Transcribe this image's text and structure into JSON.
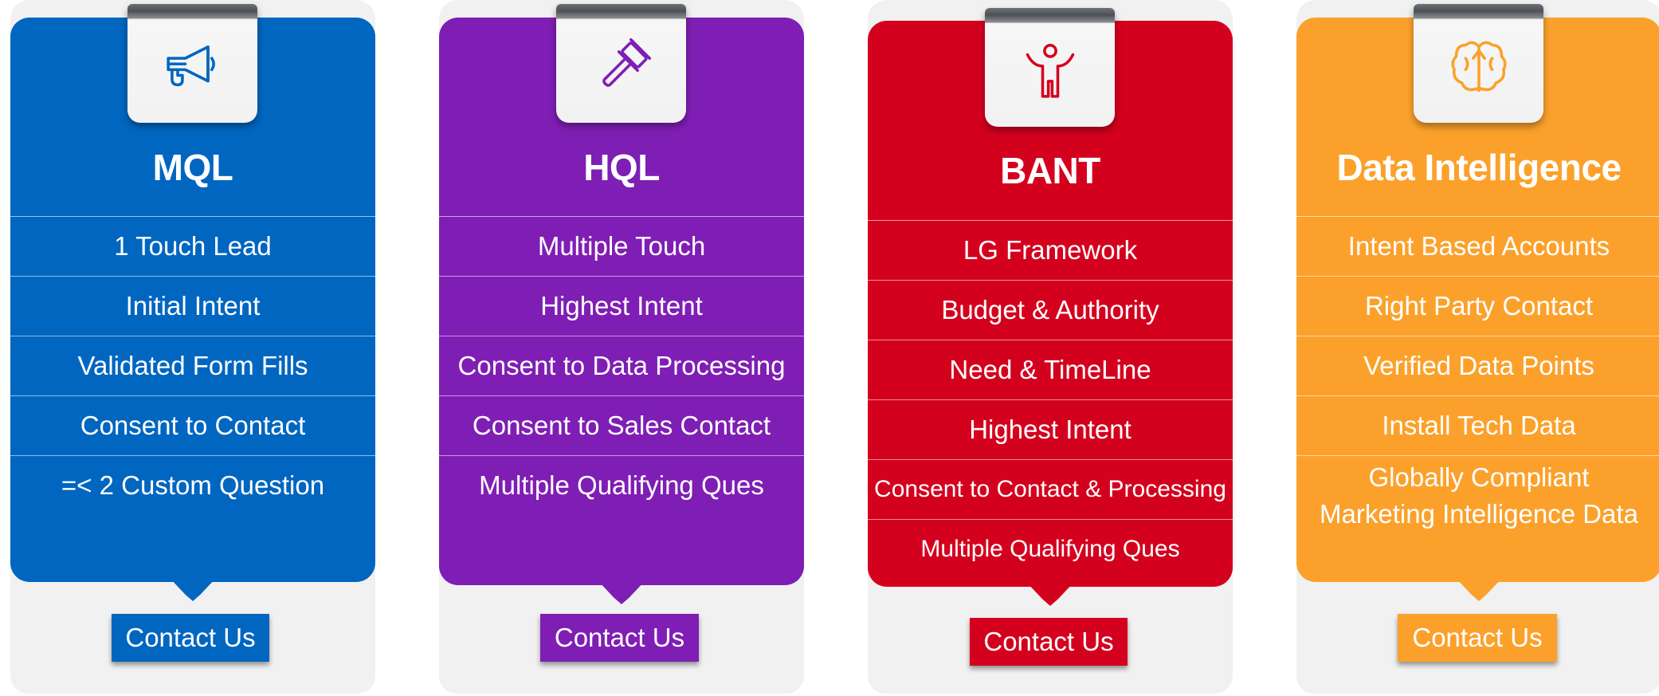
{
  "colors": {
    "mql": "#0066c0",
    "hql": "#7f1eb4",
    "bant": "#d4011e",
    "data": "#fba12b"
  },
  "cards": [
    {
      "icon": "megaphone-icon",
      "title": "MQL",
      "features": [
        "1 Touch Lead",
        "Initial Intent",
        "Validated Form Fills",
        "Consent to Contact",
        "=< 2 Custom Question"
      ],
      "button": "Contact Us"
    },
    {
      "icon": "gavel-icon",
      "title": "HQL",
      "features": [
        "Multiple Touch",
        "Highest Intent",
        "Consent to Data Processing",
        "Consent to Sales Contact",
        "Multiple Qualifying Ques"
      ],
      "button": "Contact Us"
    },
    {
      "icon": "person-icon",
      "title": "BANT",
      "features": [
        "LG Framework",
        "Budget & Authority",
        "Need & TimeLine",
        "Highest Intent",
        "Consent to Contact & Processing",
        "Multiple Qualifying Ques"
      ],
      "button": "Contact Us"
    },
    {
      "icon": "brain-icon",
      "title": "Data Intelligence",
      "features": [
        "Intent Based Accounts",
        "Right Party Contact",
        "Verified Data Points",
        "Install Tech Data",
        "Globally Compliant",
        "Marketing Intelligence Data"
      ],
      "button": "Contact Us"
    }
  ]
}
